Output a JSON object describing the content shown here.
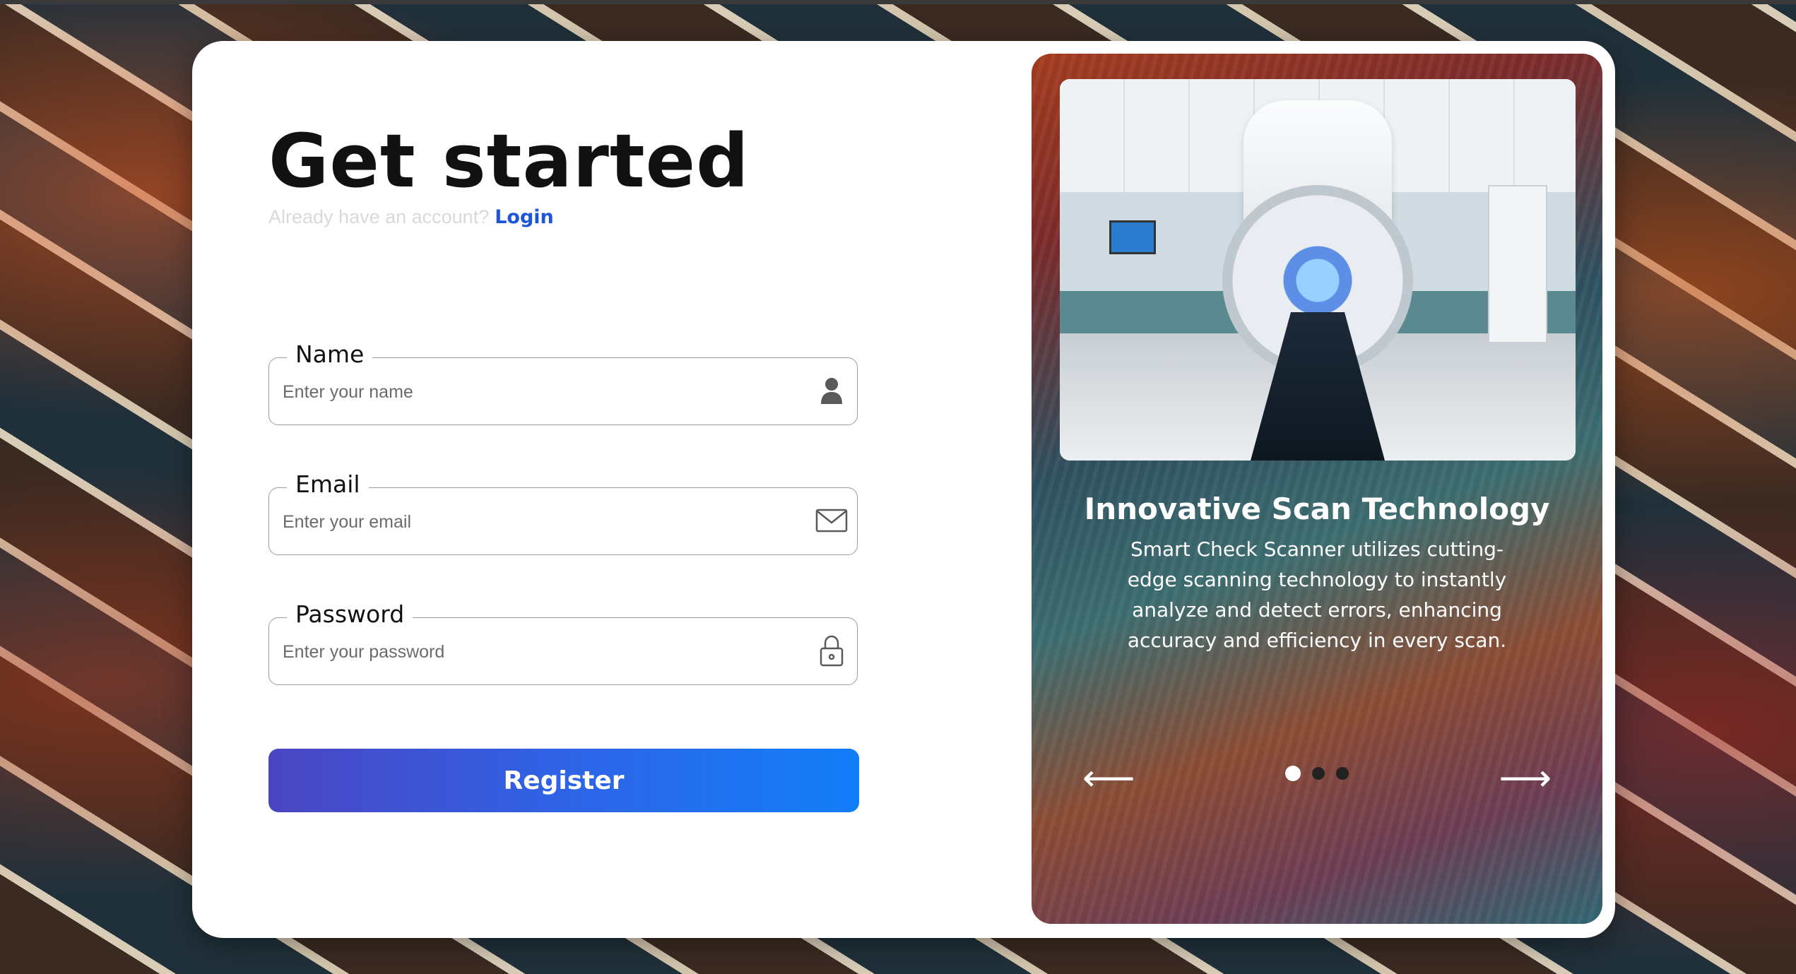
{
  "form": {
    "title": "Get started",
    "subtitle": "Already have an account?",
    "login_link": "Login",
    "fields": {
      "name": {
        "label": "Name",
        "placeholder": "Enter your name",
        "icon": "user-icon"
      },
      "email": {
        "label": "Email",
        "placeholder": "Enter your email",
        "icon": "envelope-icon"
      },
      "password": {
        "label": "Password",
        "placeholder": "Enter your password",
        "icon": "lock-icon"
      }
    },
    "register_label": "Register"
  },
  "carousel": {
    "title": "Innovative Scan Technology",
    "description": "Smart Check Scanner utilizes cutting-edge scanning technology to instantly analyze and detect errors, enhancing accuracy and efficiency in every scan.",
    "prev_icon": "arrow-left-icon",
    "next_icon": "arrow-right-icon",
    "prev_glyph": "⟵",
    "next_glyph": "⟶",
    "slide_count": 3,
    "active_index": 0
  },
  "colors": {
    "primary": "#1d55d8",
    "button_start": "#4b45c2",
    "button_end": "#117ef7",
    "card_bg": "#ffffff"
  }
}
